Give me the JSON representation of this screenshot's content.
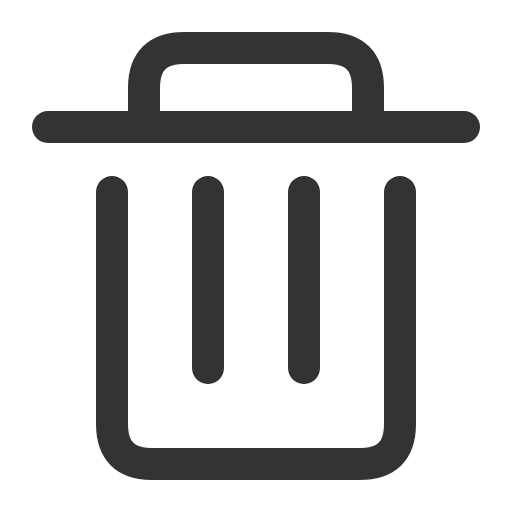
{
  "icon": {
    "name": "trash-icon",
    "stroke_color": "#333333",
    "background_color": "#ffffff"
  }
}
